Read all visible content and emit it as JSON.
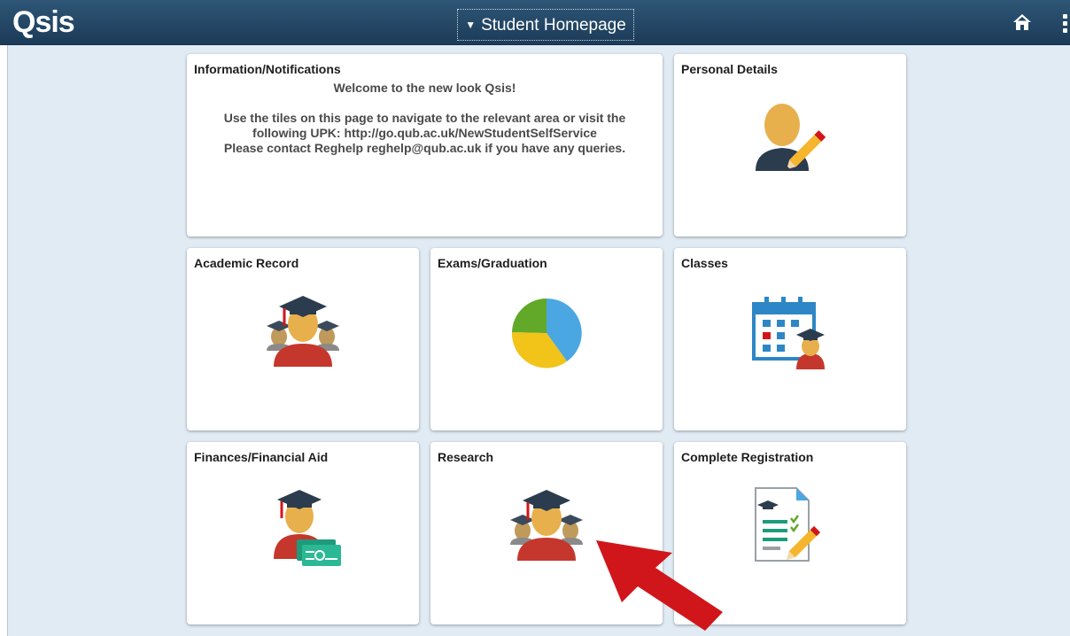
{
  "header": {
    "logo": "Qsis",
    "title": "Student Homepage",
    "icons": {
      "home": "home-icon",
      "menu": "kebab-menu-icon"
    }
  },
  "tiles": {
    "info": {
      "title": "Information/Notifications",
      "line1": "Welcome to the new look Qsis!",
      "line2": "Use the tiles on this page to navigate to the relevant area or visit the",
      "line3": "following UPK: http://go.qub.ac.uk/NewStudentSelfService",
      "line4": "Please contact Reghelp reghelp@qub.ac.uk if you have any queries."
    },
    "personal": {
      "title": "Personal Details",
      "icon": "person-edit-icon"
    },
    "academic": {
      "title": "Academic Record",
      "icon": "graduates-icon"
    },
    "exams": {
      "title": "Exams/Graduation",
      "icon": "pie-chart-icon"
    },
    "classes": {
      "title": "Classes",
      "icon": "calendar-graduate-icon"
    },
    "finances": {
      "title": "Finances/Financial Aid",
      "icon": "graduate-money-icon"
    },
    "research": {
      "title": "Research",
      "icon": "graduates-icon"
    },
    "registration": {
      "title": "Complete Registration",
      "icon": "checklist-document-icon"
    }
  },
  "annotation": {
    "icon": "red-arrow-icon",
    "color": "#d0161b"
  },
  "colors": {
    "header": "#1f4262",
    "background": "#e1ebf4",
    "tile": "#ffffff",
    "gown": "#c5372c",
    "skin": "#e7b04d",
    "cap": "#2b3c4f"
  }
}
